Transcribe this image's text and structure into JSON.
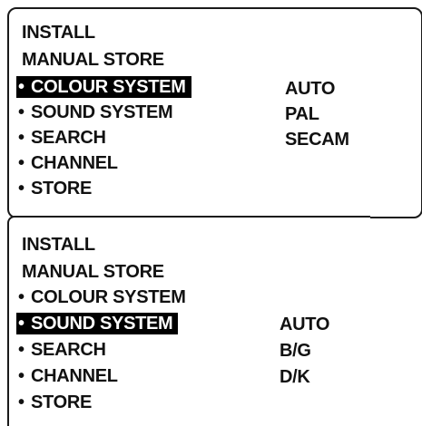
{
  "screen1": {
    "title": "INSTALL",
    "subtitle": "MANUAL STORE",
    "bullet": "•",
    "items": [
      {
        "label": "COLOUR SYSTEM",
        "selected": true
      },
      {
        "label": "SOUND SYSTEM",
        "selected": false
      },
      {
        "label": "SEARCH",
        "selected": false
      },
      {
        "label": "CHANNEL",
        "selected": false
      },
      {
        "label": "STORE",
        "selected": false
      }
    ],
    "options": [
      "AUTO",
      "PAL",
      "SECAM"
    ]
  },
  "screen2": {
    "title": "INSTALL",
    "subtitle": "MANUAL STORE",
    "bullet": "•",
    "items": [
      {
        "label": "COLOUR SYSTEM",
        "selected": false
      },
      {
        "label": "SOUND SYSTEM",
        "selected": true
      },
      {
        "label": "SEARCH",
        "selected": false
      },
      {
        "label": "CHANNEL",
        "selected": false
      },
      {
        "label": "STORE",
        "selected": false
      }
    ],
    "options": [
      "AUTO",
      "B/G",
      "D/K"
    ]
  }
}
